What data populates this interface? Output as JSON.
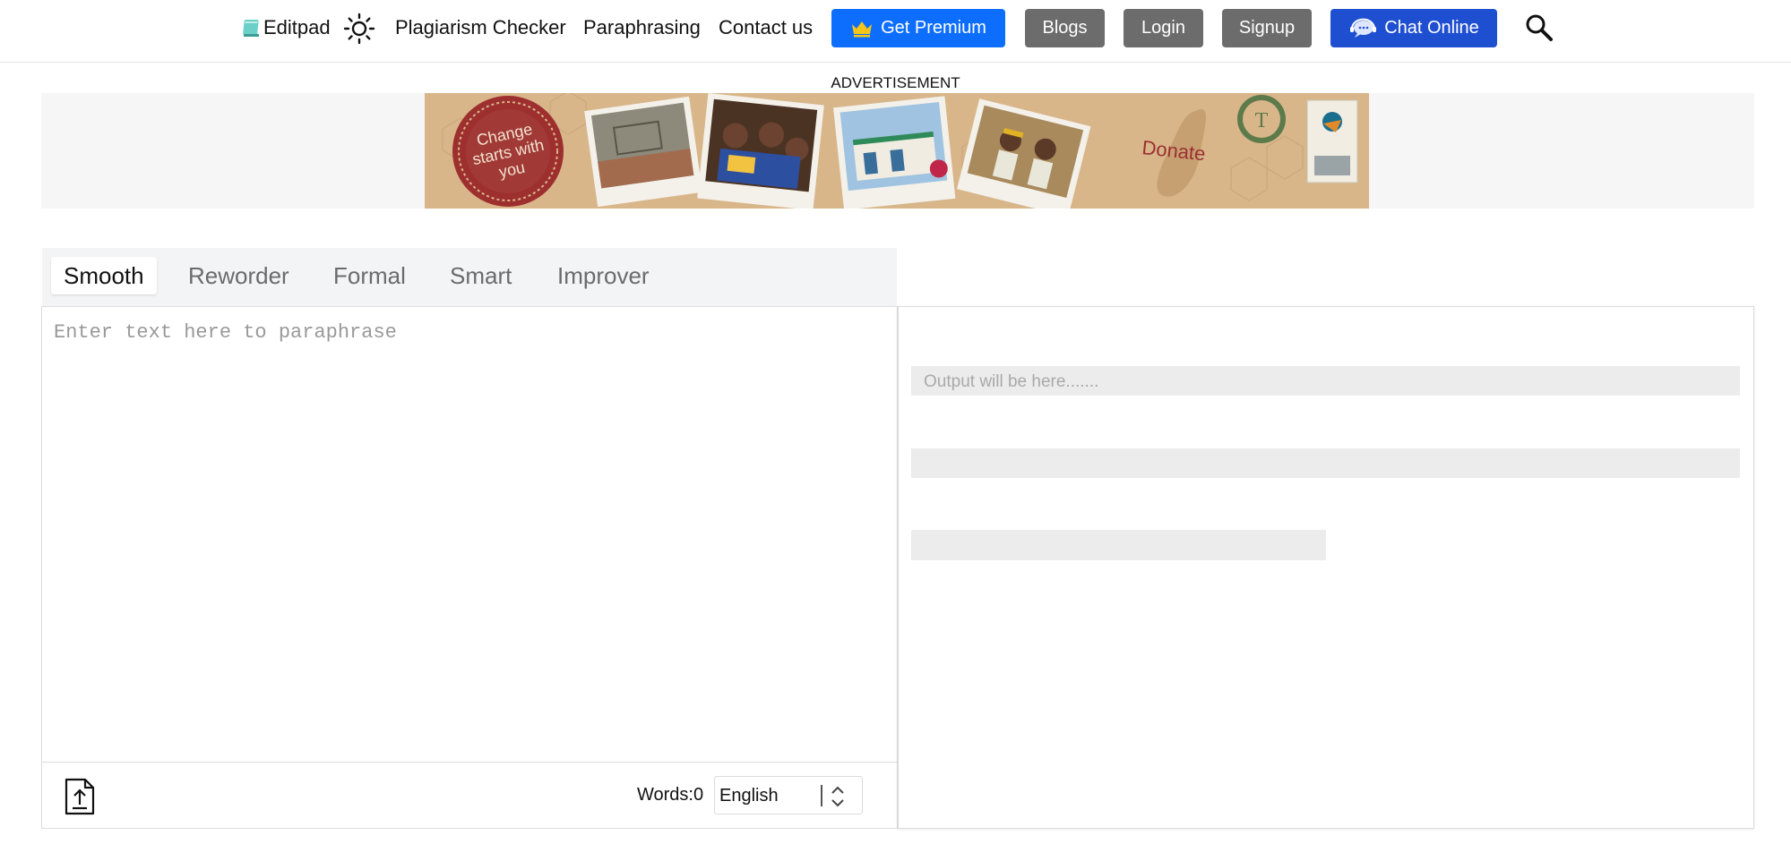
{
  "header": {
    "brand": "Editpad",
    "nav": {
      "plagiarism": "Plagiarism Checker",
      "paraphrasing": "Paraphrasing",
      "contact": "Contact us"
    },
    "buttons": {
      "premium": "Get Premium",
      "blogs": "Blogs",
      "login": "Login",
      "signup": "Signup",
      "chat": "Chat Online"
    },
    "icons": {
      "logo": "notebook-icon",
      "theme": "sun-icon",
      "premium": "crown-icon",
      "chat": "chat-headset-icon",
      "search": "search-icon"
    }
  },
  "ad": {
    "label": "ADVERTISEMENT",
    "banner": {
      "stamp_text": [
        "Change",
        "starts with",
        "you"
      ],
      "donate": "Donate"
    }
  },
  "tabs": [
    {
      "label": "Smooth",
      "active": true
    },
    {
      "label": "Reworder",
      "active": false
    },
    {
      "label": "Formal",
      "active": false
    },
    {
      "label": "Smart",
      "active": false
    },
    {
      "label": "Improver",
      "active": false
    }
  ],
  "editor": {
    "placeholder": "Enter text here to paraphrase",
    "value": "",
    "word_count": "Words:0",
    "language": "English",
    "upload_icon": "file-upload-icon"
  },
  "output": {
    "placeholder": "Output will be here......."
  },
  "colors": {
    "premium_button": "#0d6efd",
    "chat_button": "#1f4fd1",
    "gray_button": "#6c6c6c",
    "crown": "#f5c518",
    "tab_bar": "#f3f4f6",
    "output_skeleton": "#ececec"
  }
}
